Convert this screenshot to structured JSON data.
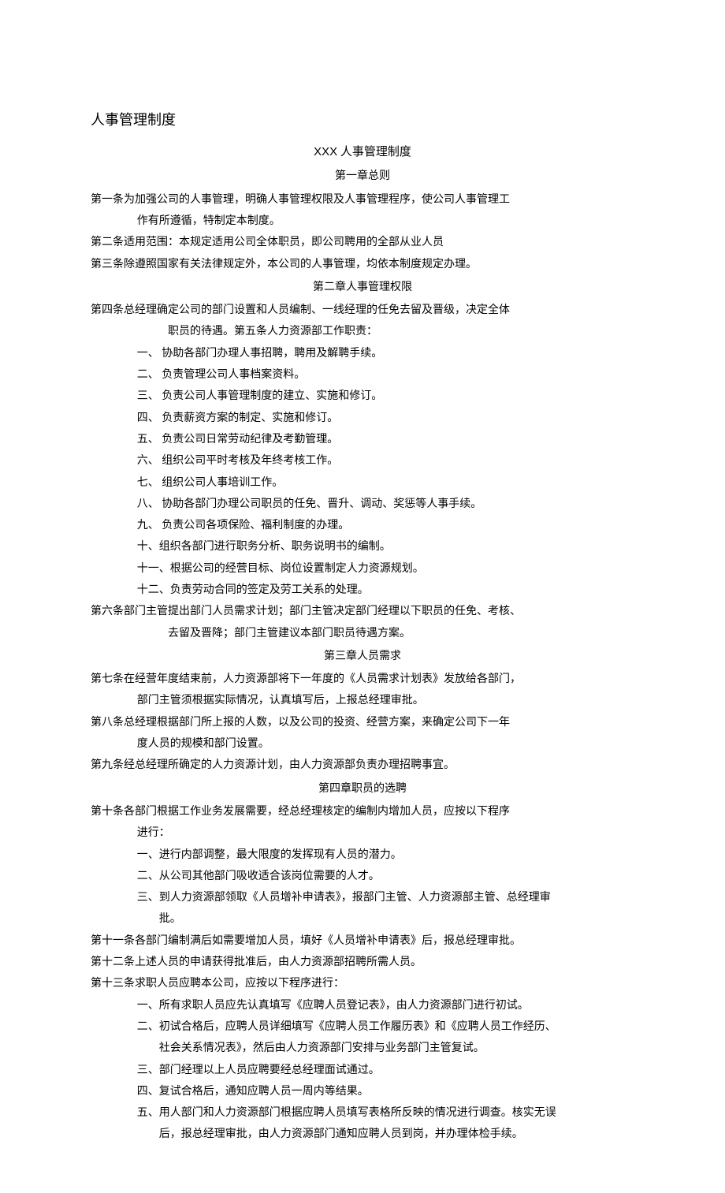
{
  "doc_title": "人事管理制度",
  "subtitle_prefix": "XXX",
  "subtitle_suffix": " 人事管理制度",
  "chapter1": "第一章总则",
  "a1_l1": "第一条为加强公司的人事管理，明确人事管理权限及人事管理程序，使公司人事管理工",
  "a1_l2": "作有所遵循，特制定本制度。",
  "a2": "第二条适用范围：本规定适用公司全体职员，即公司聘用的全部从业人员",
  "a3": "第三条除遵照国家有关法律规定外，本公司的人事管理，均依本制度规定办理。",
  "chapter2": "第二章人事管理权限",
  "a4_l1": "第四条总经理确定公司的部门设置和人员编制、一线经理的任免去留及晋级，决定全体",
  "a4_l2": "职员的待遇。第五条人力资源部工作职责：",
  "li1": "一、   协助各部门办理人事招聘，聘用及解聘手续。",
  "li2": "二、   负责管理公司人事档案资料。",
  "li3": "三、   负责公司人事管理制度的建立、实施和修订。",
  "li4": "四、   负责薪资方案的制定、实施和修订。",
  "li5": "五、   负责公司日常劳动纪律及考勤管理。",
  "li6": "六、   组织公司平时考核及年终考核工作。",
  "li7": "七、   组织公司人事培训工作。",
  "li8": "八、   协助各部门办理公司职员的任免、晋升、调动、奖惩等人事手续。",
  "li9": "九、   负责公司各项保险、福利制度的办理。",
  "li10": "十、组织各部门进行职务分析、职务说明书的编制。",
  "li11": "十一、根据公司的经营目标、岗位设置制定人力资源规划。",
  "li12": "十二、负责劳动合同的签定及劳工关系的处理。",
  "a6_l1": "第六条部门主管提出部门人员需求计划；部门主管决定部门经理以下职员的任免、考核、",
  "a6_l2": "去留及晋降；部门主管建议本部门职员待遇方案。",
  "chapter3": "第三章人员需求",
  "a7_l1": "第七条在经营年度结束前，人力资源部将下一年度的《人员需求计划表》发放给各部门，",
  "a7_l2": "部门主管须根据实际情况，认真填写后，上报总经理审批。",
  "a8_l1": "第八条总经理根据部门所上报的人数，以及公司的投资、经营方案，来确定公司下一年",
  "a8_l2": "度人员的规模和部门设置。",
  "a9": "第九条经总经理所确定的人力资源计划，由人力资源部负责办理招聘事宜。",
  "chapter4": "第四章职员的选聘",
  "a10_l1": "第十条各部门根据工作业务发展需要，经总经理核定的编制内增加人员，应按以下程序",
  "a10_l2": "进行：",
  "a10_i1": "一、进行内部调整，最大限度的发挥现有人员的潜力。",
  "a10_i2": "二、从公司其他部门吸收适合该岗位需要的人才。",
  "a10_i3a": "三、到人力资源部领取《人员增补申请表》，报部门主管、人力资源部主管、总经理审",
  "a10_i3b": "批。",
  "a11": "第十一条各部门编制满后如需要增加人员，填好《人员增补申请表》后，报总经理审批。",
  "a12": "第十二条上述人员的申请获得批准后，由人力资源部招聘所需人员。",
  "a13": "第十三条求职人员应聘本公司，应按以下程序进行：",
  "a13_i1": "一、所有求职人员应先认真填写《应聘人员登记表》，由人力资源部门进行初试。",
  "a13_i2a": "二、初试合格后，应聘人员详细填写《应聘人员工作履历表》和《应聘人员工作经历、",
  "a13_i2b": "社会关系情况表》，然后由人力资源部门安排与业务部门主管复试。",
  "a13_i3": "三、部门经理以上人员应聘要经总经理面试通过。",
  "a13_i4": "四、复试合格后，通知应聘人员一周内等结果。",
  "a13_i5a": "五、用人部门和人力资源部门根据应聘人员填写表格所反映的情况进行调查。核实无误",
  "a13_i5b": "后，报总经理审批，由人力资源部门通知应聘人员到岗，并办理体检手续。"
}
